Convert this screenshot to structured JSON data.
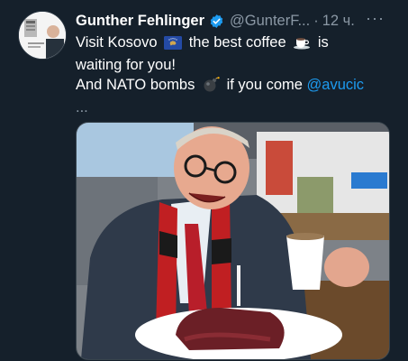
{
  "author": {
    "name": "Gunther Fehlinger",
    "handle": "@GunterF...",
    "separator": "·",
    "time": "12 ч."
  },
  "more_glyph": "···",
  "tweet": {
    "line1_a": "Visit Kosovo",
    "line1_b": "the best coffee",
    "line1_c": "is",
    "line2": "waiting for you!",
    "line3_a": "And NATO bombs",
    "line3_b": "if you come",
    "mention": "@avucic",
    "truncation": "..."
  },
  "icons": {
    "verified": "verified-badge-icon",
    "kosovo_flag": "kosovo-flag-icon",
    "coffee": "coffee-cup-icon",
    "bomb": "bomb-icon",
    "more": "more-options-icon"
  },
  "colors": {
    "background": "#15202b",
    "text": "#ffffff",
    "secondary": "#8b98a5",
    "accent": "#1d9bf0"
  }
}
